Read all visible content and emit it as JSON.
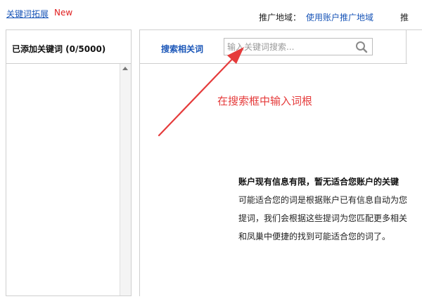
{
  "top": {
    "link_label": "关键词拓展",
    "new_badge": "New",
    "region_label": "推广地域：",
    "region_value": "使用账户推广地域",
    "cut_text": "推"
  },
  "left_panel": {
    "title": "已添加关键词 (0/5000)"
  },
  "right_panel": {
    "search_related_label": "搜索相关词",
    "search_placeholder": "输入关键词搜索...",
    "annotation": "在搜索框中输入词根",
    "message": {
      "title": "账户现有信息有限，暂无适合您账户的关键",
      "line1": "可能适合您的词是根据账户已有信息自动为您",
      "line2": "提词，我们会根据这些提词为您匹配更多相关",
      "line3": "和凤巢中便捷的找到可能适合您的词了。"
    }
  },
  "colors": {
    "link": "#1a56b8",
    "badge": "#e02020",
    "annotation": "#e53b3b",
    "border": "#cfcfcf"
  },
  "icons": {
    "search": "search-icon",
    "scroll_up": "scroll-up-arrow-icon",
    "arrow": "annotation-arrow-icon"
  }
}
